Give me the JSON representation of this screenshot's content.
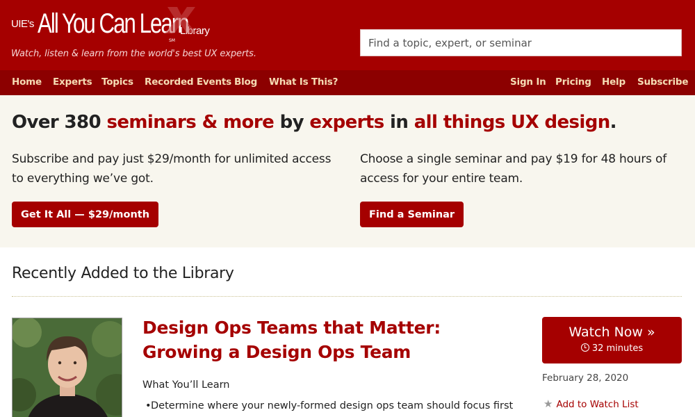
{
  "header": {
    "logo_pre": "UIE's",
    "logo_main": "All You Can Learn",
    "logo_post": "Library",
    "logo_sm": "SM",
    "tagline": "Watch, listen & learn from the world's best UX experts.",
    "search_placeholder": "Find a topic, expert, or seminar"
  },
  "nav": {
    "left": [
      "Home",
      "Experts",
      "Topics",
      "Recorded Events",
      "Blog",
      "What Is This?"
    ],
    "right": [
      "Sign In",
      "Pricing",
      "Help",
      "Subscribe"
    ]
  },
  "hero": {
    "headline": {
      "p1": "Over 380 ",
      "h1": "seminars & more",
      "p2": " by ",
      "h2": "experts",
      "p3": " in ",
      "h3": "all things UX design",
      "p4": "."
    },
    "left_copy": "Subscribe and pay just $29/month for unlimited access to everything we’ve got.",
    "right_copy": "Choose a single seminar and pay $19 for 48 hours of access for your entire team.",
    "left_button": "Get It All — $29/month",
    "right_button": "Find a Seminar"
  },
  "recent": {
    "section_title": "Recently Added to the Library",
    "item": {
      "title": "Design Ops Teams that Matter: Growing a Design Ops Team",
      "learn_label": "What You’ll Learn",
      "bullets": [
        "Determine where your newly-formed design ops team should focus first"
      ],
      "watch_label": "Watch Now »",
      "duration": "32 minutes",
      "date": "February 28, 2020",
      "watchlist_label": "Add to Watch List"
    }
  },
  "colors": {
    "brand": "#a50000",
    "nav_bg": "#8c0000",
    "nav_text": "#f6dcb4",
    "hero_bg": "#f8f6ee"
  }
}
